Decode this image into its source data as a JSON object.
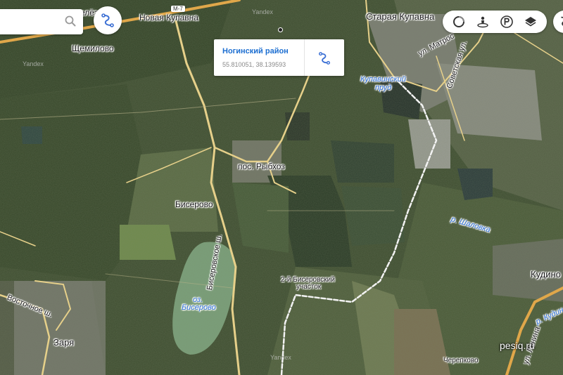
{
  "labels": {
    "novaya_kupavna": "Новая Купавна",
    "staraya_kupavna": "Старая Купавна",
    "shchemilovo": "Щемилово",
    "ryb": "пос. Рыбхоз",
    "biserovo": "Бисерово",
    "kudino": "Кудино",
    "zarya": "Заря",
    "cherepkovo": "Черепково",
    "ucha_line1": "2-й Бисеровский",
    "ucha_line2": "участок",
    "top_fragment": "елёз",
    "m7": "М-7",
    "yandex_1": "Yandex",
    "yandex_2": "Yandex",
    "yandex_3": "Yandex",
    "kupavinsky_1": "Купавинский",
    "kupavinsky_2": "пруд",
    "lake_1": "оз.",
    "lake_2": "Бисерово",
    "shalovka": "р. Шаловка",
    "kudinka": "р. Кудин",
    "biserovskoe": "Бисеровское ш.",
    "vostochnoe": "Восточное ш.",
    "matrosova": "ул. Матрос",
    "sovetskaya": "Советская ул.",
    "lenina": "ул. Ленина",
    "watermark": "pesiq.ru"
  },
  "popup": {
    "title": "Ногинский район",
    "coords": "55.810051, 38.139593"
  },
  "search": {
    "value": ""
  },
  "icons": {
    "search": "search-icon",
    "route": "route-icon",
    "traffic": "traffic-icon",
    "panorama": "panorama-icon",
    "parking": "parking-icon",
    "layers": "layers-icon"
  },
  "colors": {
    "link": "#1c6ed1",
    "water_label": "#2d6fd6",
    "road": "#e6d08a",
    "highway": "#e0a74a"
  }
}
